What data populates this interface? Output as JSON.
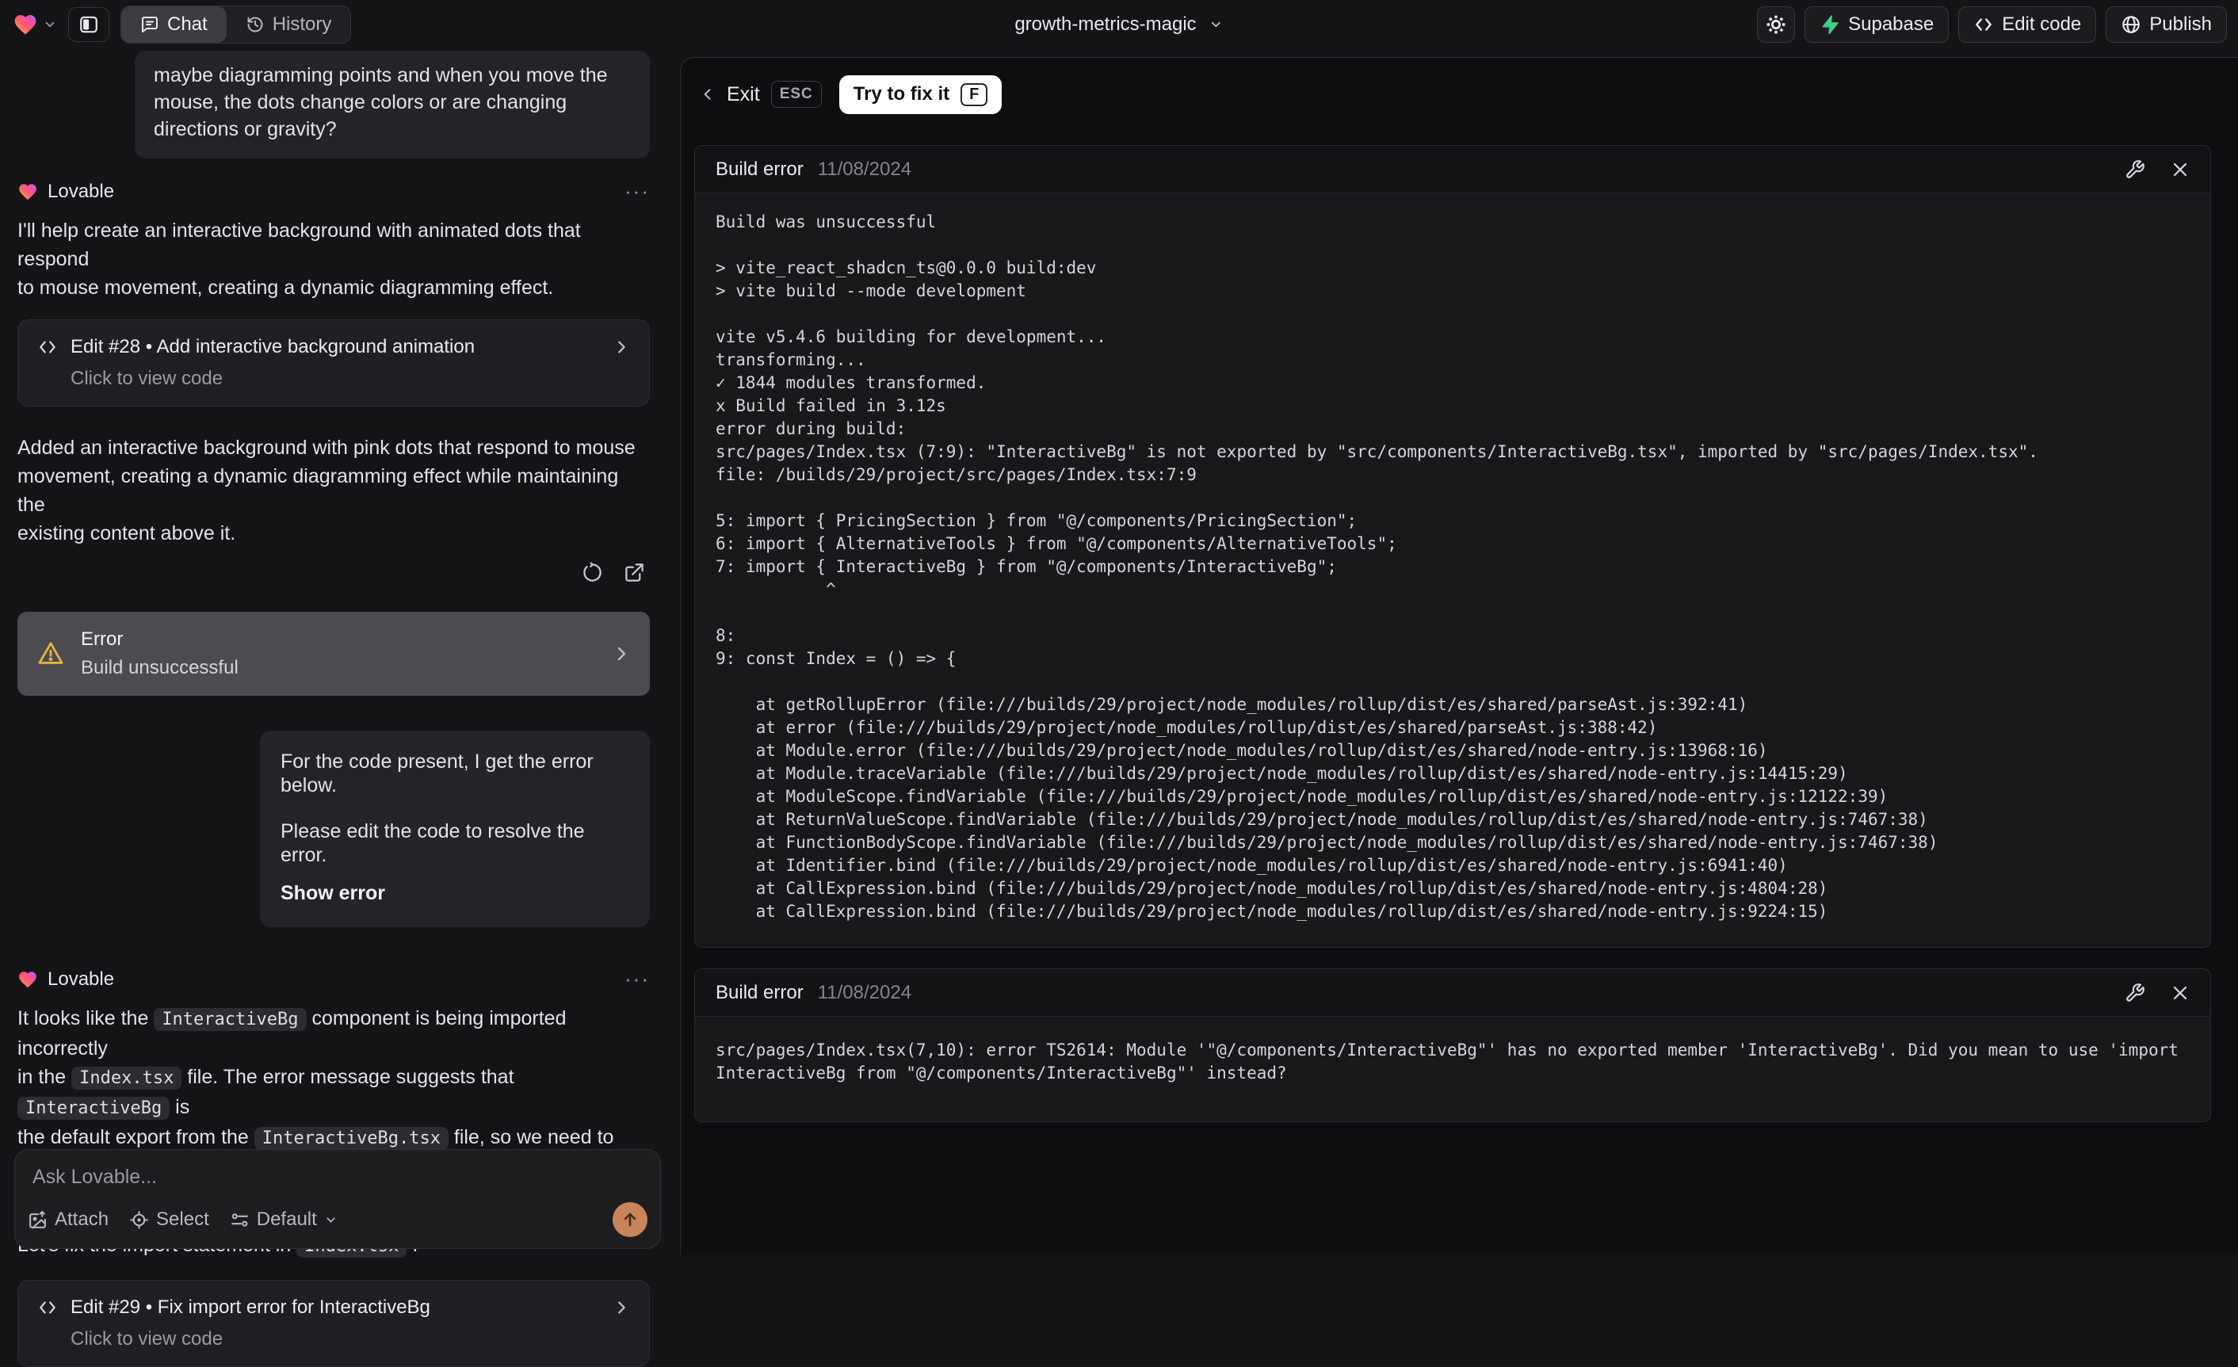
{
  "topbar": {
    "tabs": {
      "chat": "Chat",
      "history": "History"
    },
    "project_name": "growth-metrics-magic",
    "supabase_label": "Supabase",
    "edit_code_label": "Edit code",
    "publish_label": "Publish"
  },
  "chat": {
    "assistant_name": "Lovable",
    "menu_ellipsis": "···",
    "user_message_1": "maybe diagramming points and when you move the\nmouse, the dots change colors or are changing\ndirections or gravity?",
    "assistant_message_1": "I'll help create an interactive background with animated dots that respond\nto mouse movement, creating a dynamic diagramming effect.",
    "edit_card_28": {
      "title": "Edit #28 • Add interactive background animation",
      "subtitle": "Click to view code"
    },
    "assistant_message_2": "Added an interactive background with pink dots that respond to mouse\nmovement, creating a dynamic diagramming effect while maintaining the\nexisting content above it.",
    "error_card": {
      "title": "Error",
      "subtitle": "Build unsuccessful"
    },
    "user_message_2": {
      "line1": "For the code present, I get the error below.",
      "line2": "Please edit the code to resolve the error.",
      "action": "Show error"
    },
    "assistant_message_3_segments": [
      {
        "t": "text",
        "v": "It looks like the "
      },
      {
        "t": "code",
        "v": "InteractiveBg"
      },
      {
        "t": "text",
        "v": " component is being imported incorrectly\nin the "
      },
      {
        "t": "code",
        "v": "Index.tsx"
      },
      {
        "t": "text",
        "v": " file. The error message suggests that "
      },
      {
        "t": "code",
        "v": "InteractiveBg"
      },
      {
        "t": "text",
        "v": " is\nthe default export from the "
      },
      {
        "t": "code",
        "v": "InteractiveBg.tsx"
      },
      {
        "t": "text",
        "v": " file, so we need to adjust\nthe import statement accordingly."
      }
    ],
    "assistant_message_4_segments": [
      {
        "t": "text",
        "v": "Let's fix the import statement in "
      },
      {
        "t": "code",
        "v": "Index.tsx"
      },
      {
        "t": "text",
        "v": " ."
      }
    ],
    "edit_card_29": {
      "title": "Edit #29 • Fix import error for InteractiveBg",
      "subtitle": "Click to view code"
    }
  },
  "composer": {
    "placeholder": "Ask Lovable...",
    "attach_label": "Attach",
    "select_label": "Select",
    "mode_label": "Default"
  },
  "overlay": {
    "exit_label": "Exit",
    "exit_shortcut": "ESC",
    "fix_label": "Try to fix it",
    "fix_shortcut": "F",
    "panel1": {
      "title": "Build error",
      "date": "11/08/2024",
      "log_lines": [
        "Build was unsuccessful",
        "",
        "> vite_react_shadcn_ts@0.0.0 build:dev",
        "> vite build --mode development",
        "",
        "vite v5.4.6 building for development...",
        "transforming...",
        "✓ 1844 modules transformed.",
        "x Build failed in 3.12s",
        "error during build:",
        "src/pages/Index.tsx (7:9): \"InteractiveBg\" is not exported by \"src/components/InteractiveBg.tsx\", imported by \"src/pages/Index.tsx\".",
        "file: /builds/29/project/src/pages/Index.tsx:7:9",
        "",
        "5: import { PricingSection } from \"@/components/PricingSection\";",
        "6: import { AlternativeTools } from \"@/components/AlternativeTools\";",
        "7: import { InteractiveBg } from \"@/components/InteractiveBg\";",
        "           ^",
        "",
        "8: ",
        "9: const Index = () => {",
        "",
        "    at getRollupError (file:///builds/29/project/node_modules/rollup/dist/es/shared/parseAst.js:392:41)",
        "    at error (file:///builds/29/project/node_modules/rollup/dist/es/shared/parseAst.js:388:42)",
        "    at Module.error (file:///builds/29/project/node_modules/rollup/dist/es/shared/node-entry.js:13968:16)",
        "    at Module.traceVariable (file:///builds/29/project/node_modules/rollup/dist/es/shared/node-entry.js:14415:29)",
        "    at ModuleScope.findVariable (file:///builds/29/project/node_modules/rollup/dist/es/shared/node-entry.js:12122:39)",
        "    at ReturnValueScope.findVariable (file:///builds/29/project/node_modules/rollup/dist/es/shared/node-entry.js:7467:38)",
        "    at FunctionBodyScope.findVariable (file:///builds/29/project/node_modules/rollup/dist/es/shared/node-entry.js:7467:38)",
        "    at Identifier.bind (file:///builds/29/project/node_modules/rollup/dist/es/shared/node-entry.js:6941:40)",
        "    at CallExpression.bind (file:///builds/29/project/node_modules/rollup/dist/es/shared/node-entry.js:4804:28)",
        "    at CallExpression.bind (file:///builds/29/project/node_modules/rollup/dist/es/shared/node-entry.js:9224:15)"
      ]
    },
    "panel2": {
      "title": "Build error",
      "date": "11/08/2024",
      "log_lines": [
        "src/pages/Index.tsx(7,10): error TS2614: Module '\"@/components/InteractiveBg\"' has no exported member 'InteractiveBg'. Did you mean to use 'import InteractiveBg from \"@/components/InteractiveBg\"' instead?"
      ]
    }
  },
  "colors": {
    "warning": "#e3b341",
    "supabase_green": "#3ecf8e",
    "send_button": "#c9845a"
  }
}
